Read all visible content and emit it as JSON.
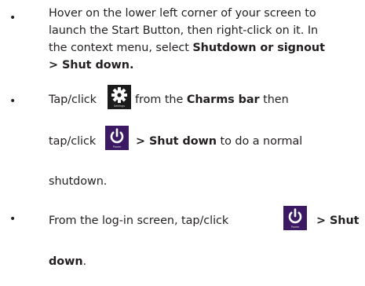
{
  "bullet_char": "•",
  "item1": {
    "line1": "Hover on the lower left corner of your screen to",
    "line2": "launch the Start Button, then right-click on it. In",
    "line3_plain": "the context menu, select ",
    "line3_bold": "Shutdown or signout",
    "line4_bold": "> Shut down."
  },
  "item2": {
    "line1_prefix": "Tap/click",
    "line1_middle": "from  the ",
    "line1_bold": "Charms bar",
    "line1_suffix": " then",
    "line2_prefix": "tap/click",
    "line2_bold": "> Shut down",
    "line2_suffix": " to do a normal",
    "line3": "shutdown."
  },
  "item3": {
    "line1_prefix": "From the log-in screen, tap/click",
    "line1_bold": "> Shut",
    "line2_bold": "down",
    "line2_suffix": "."
  },
  "icons": {
    "settings_caption": "Settings",
    "power_caption": "Power",
    "gear_color": "#ffffff",
    "power_bg": "#3b1a63",
    "settings_bg": "#1b1b1b"
  }
}
